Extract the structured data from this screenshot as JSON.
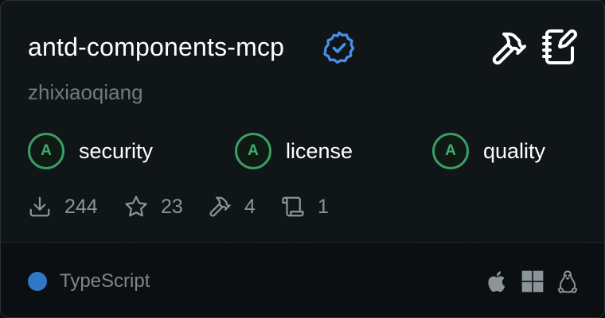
{
  "server": {
    "name": "antd-components-mcp",
    "author": "zhixiaoqiang"
  },
  "header_icons": [
    "verified-badge-icon",
    "hammer-icon",
    "notebook-pen-icon"
  ],
  "grades": [
    {
      "letter": "A",
      "label": "security"
    },
    {
      "letter": "A",
      "label": "license"
    },
    {
      "letter": "A",
      "label": "quality"
    }
  ],
  "stats": {
    "downloads": "244",
    "stars": "23",
    "tools": "4",
    "prompts": "1"
  },
  "language": {
    "name": "TypeScript",
    "color": "#3178c6"
  },
  "platforms": [
    "apple-icon",
    "windows-icon",
    "linux-icon"
  ],
  "colors": {
    "card_bg": "#101518",
    "grade_green": "#3fae6c",
    "verified_blue": "#4a8fe8",
    "muted_text": "#6e7c7d"
  }
}
